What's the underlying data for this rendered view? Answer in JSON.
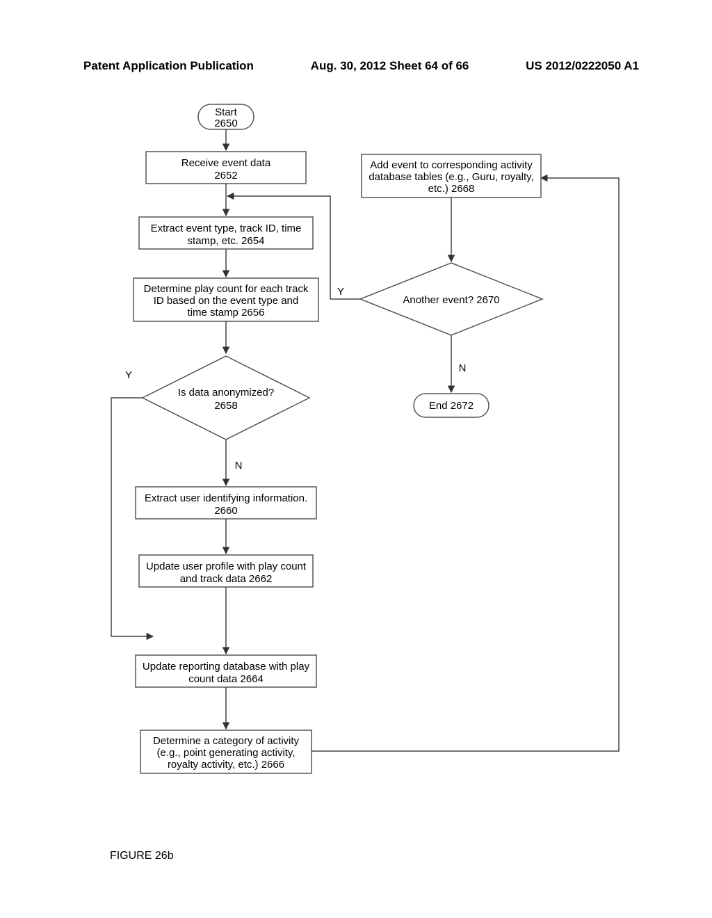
{
  "header": {
    "left": "Patent Application Publication",
    "center": "Aug. 30, 2012  Sheet 64 of 66",
    "right": "US 2012/0222050 A1"
  },
  "figure_label": "FIGURE 26b",
  "nodes": {
    "start": {
      "text1": "Start",
      "text2": "2650"
    },
    "receive": {
      "text1": "Receive event data",
      "text2": "2652"
    },
    "extract_type": {
      "text1": "Extract event type, track ID, time",
      "text2": "stamp, etc. 2654"
    },
    "determine_play": {
      "text1": "Determine play count for each track",
      "text2": "ID based on the event type and",
      "text3": "time stamp 2656"
    },
    "anonymized": {
      "text1": "Is data anonymized?",
      "text2": "2658"
    },
    "extract_user": {
      "text1": "Extract user identifying information.",
      "text2": "2660"
    },
    "update_profile": {
      "text1": "Update user profile with play count",
      "text2": "and track data 2662"
    },
    "update_reporting": {
      "text1": "Update reporting database with play",
      "text2": "count data 2664"
    },
    "determine_category": {
      "text1": "Determine a category of activity",
      "text2": "(e.g., point generating activity,",
      "text3": "royalty activity, etc.) 2666"
    },
    "add_event": {
      "text1": "Add event to corresponding activity",
      "text2": "database tables (e.g., Guru, royalty,",
      "text3": "etc.) 2668"
    },
    "another": {
      "text1": "Another event? 2670"
    },
    "end": {
      "text1": "End 2672"
    }
  },
  "labels": {
    "Y": "Y",
    "N": "N"
  }
}
